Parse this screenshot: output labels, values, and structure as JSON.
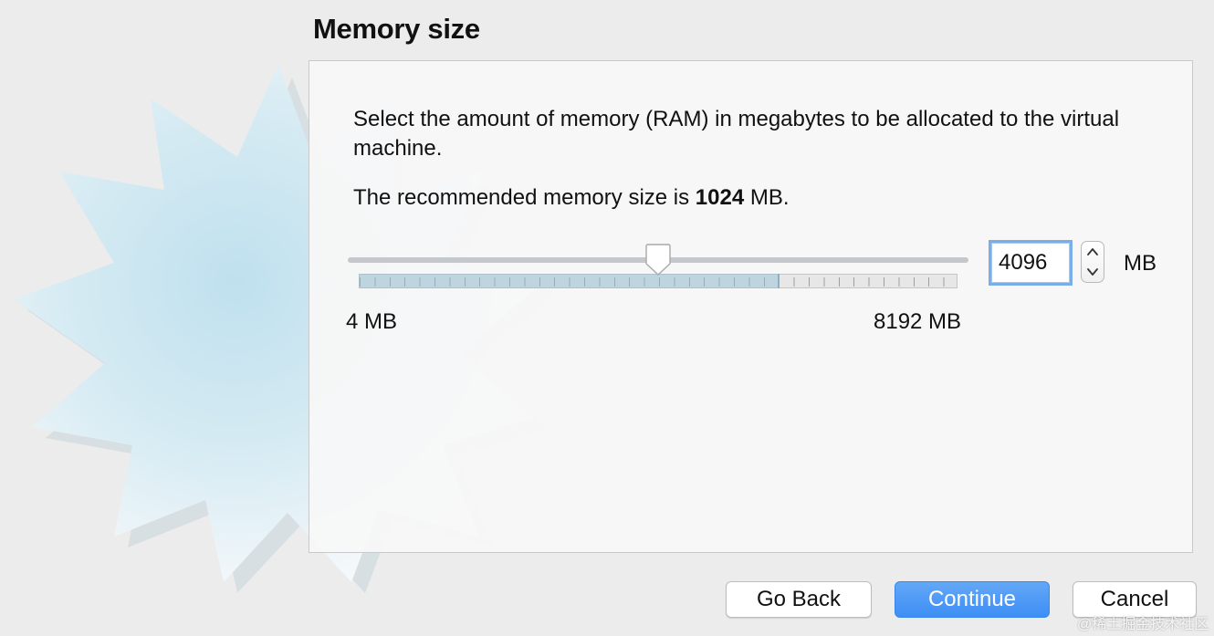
{
  "page": {
    "title": "Memory size"
  },
  "panel": {
    "description": "Select the amount of memory (RAM) in megabytes to be allocated to the virtual machine.",
    "recommend_prefix": "The recommended memory size is",
    "recommended_value": "1024",
    "recommend_suffix": "MB."
  },
  "slider": {
    "min_label": "4 MB",
    "max_label": "8192 MB",
    "min_mb": 4,
    "max_mb": 8192,
    "value_mb": 4096,
    "recommended_mb": 1024
  },
  "memory_input": {
    "value": "4096",
    "unit": "MB"
  },
  "buttons": {
    "back": "Go Back",
    "continue": "Continue",
    "cancel": "Cancel"
  },
  "watermark": "@稀土掘金技术社区",
  "colors": {
    "primary_button": "#3e8ef5",
    "focus_ring": "#7aaeea",
    "starburst": "#cfe6f0"
  },
  "icons": {
    "decoration": "starburst-icon",
    "stepper_up": "chevron-up-icon",
    "stepper_down": "chevron-down-icon"
  }
}
